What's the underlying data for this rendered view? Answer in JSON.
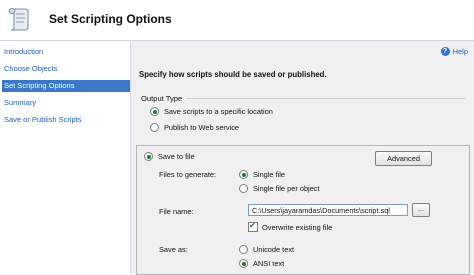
{
  "header": {
    "title": "Set Scripting Options"
  },
  "sidebar": {
    "items": [
      {
        "label": "Introduction",
        "active": false
      },
      {
        "label": "Choose Objects",
        "active": false
      },
      {
        "label": "Set Scripting Options",
        "active": true
      },
      {
        "label": "Summary",
        "active": false
      },
      {
        "label": "Save or Publish Scripts",
        "active": false
      }
    ]
  },
  "main": {
    "help_label": "Help",
    "instruction": "Specify how scripts should be saved or published.",
    "output_type": {
      "label": "Output Type",
      "options": [
        {
          "label": "Save scripts to a specific location",
          "selected": true
        },
        {
          "label": "Publish to Web service",
          "selected": false
        }
      ]
    },
    "save_to_file": {
      "label": "Save to file",
      "selected": true,
      "advanced_label": "Advanced",
      "files_to_generate": {
        "label": "Files to generate:",
        "options": [
          {
            "label": "Single file",
            "selected": true
          },
          {
            "label": "Single file per object",
            "selected": false
          }
        ]
      },
      "file_name": {
        "label": "File name:",
        "value": "C:\\Users\\jayaramdas\\Documents\\script.sql",
        "browse_label": "..."
      },
      "overwrite": {
        "label": "Overwrite existing file",
        "checked": true
      },
      "save_as": {
        "label": "Save as:",
        "options": [
          {
            "label": "Unicode text",
            "selected": false
          },
          {
            "label": "ANSI text",
            "selected": true
          }
        ]
      }
    }
  }
}
